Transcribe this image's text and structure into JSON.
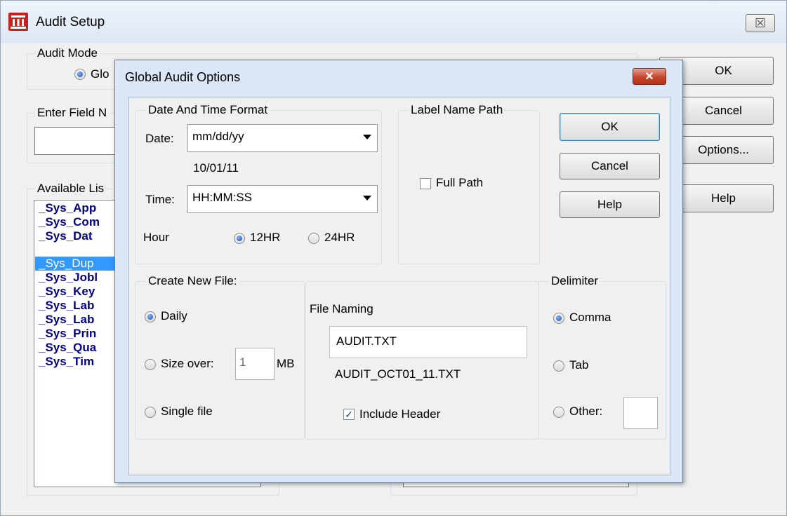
{
  "outer": {
    "title": "Audit Setup",
    "close_glyph": "☒",
    "audit_mode_label": "Audit Mode",
    "audit_mode_option": "Glo",
    "enter_field_label": "Enter Field N",
    "available_list_label": "Available Lis",
    "available_items": [
      "_Sys_App",
      "_Sys_Com",
      "_Sys_Dat",
      "_Sys_Dup",
      "_Sys_Jobl",
      "_Sys_Key",
      "_Sys_Lab",
      "_Sys_Lab",
      "_Sys_Prin",
      "_Sys_Qua",
      "_Sys_Tim"
    ],
    "ok": "OK",
    "cancel": "Cancel",
    "options": "Options...",
    "help": "Help"
  },
  "dialog": {
    "title": "Global Audit Options",
    "close_glyph": "✕",
    "date_time_group": "Date And Time Format",
    "date_label": "Date:",
    "date_value": "mm/dd/yy",
    "date_preview": "10/01/11",
    "time_label": "Time:",
    "time_value": "HH:MM:SS",
    "hour_label": "Hour",
    "hour_12": "12HR",
    "hour_24": "24HR",
    "label_name_path_group": "Label Name Path",
    "full_path": "Full Path",
    "ok": "OK",
    "cancel": "Cancel",
    "help": "Help",
    "create_file_group": "Create New File:",
    "daily": "Daily",
    "size_over": "Size over:",
    "size_value": "1",
    "size_unit": "MB",
    "single_file": "Single file",
    "file_naming_label": "File Naming",
    "file_naming_value": "AUDIT.TXT",
    "file_naming_preview": "AUDIT_OCT01_11.TXT",
    "include_header": "Include Header",
    "delimiter_group": "Delimiter",
    "comma": "Comma",
    "tab": "Tab",
    "other": "Other:",
    "other_value": ""
  },
  "colors": {
    "accent": "#000080",
    "selection": "#3399ff",
    "close_red": "#c4452a"
  }
}
